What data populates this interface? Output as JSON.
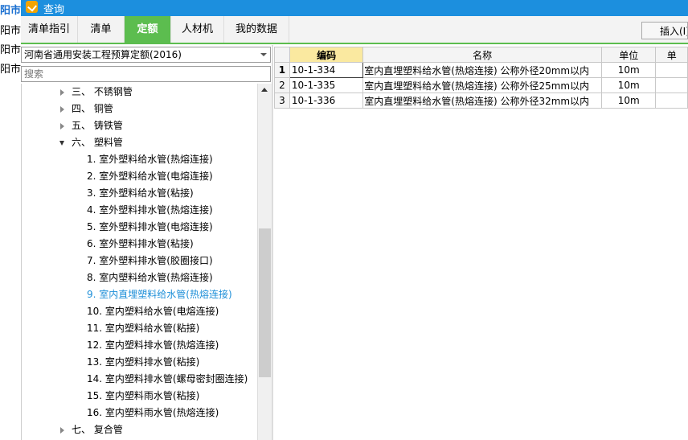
{
  "background_window": {
    "lines": [
      "阳市",
      "阳市",
      "阳市",
      "阳市"
    ]
  },
  "window": {
    "title": "查询"
  },
  "tabs": [
    {
      "label": "清单指引",
      "active": false
    },
    {
      "label": "清单",
      "active": false
    },
    {
      "label": "定额",
      "active": true
    },
    {
      "label": "人材机",
      "active": false
    },
    {
      "label": "我的数据",
      "active": false
    }
  ],
  "toolbar": {
    "insert_label": "插入(I)"
  },
  "quota_library": {
    "selected": "河南省通用安装工程预算定额(2016)"
  },
  "search": {
    "placeholder": "搜索",
    "value": ""
  },
  "tree": [
    {
      "label": "三、 不锈钢管",
      "state": "collapsed",
      "level": 0
    },
    {
      "label": "四、 铜管",
      "state": "collapsed",
      "level": 0
    },
    {
      "label": "五、 铸铁管",
      "state": "collapsed",
      "level": 0
    },
    {
      "label": "六、 塑料管",
      "state": "expanded",
      "level": 0
    },
    {
      "label": "1. 室外塑料给水管(热熔连接)",
      "level": 1
    },
    {
      "label": "2. 室外塑料给水管(电熔连接)",
      "level": 1
    },
    {
      "label": "3. 室外塑料给水管(粘接)",
      "level": 1
    },
    {
      "label": "4. 室外塑料排水管(热熔连接)",
      "level": 1
    },
    {
      "label": "5. 室外塑料排水管(电熔连接)",
      "level": 1
    },
    {
      "label": "6. 室外塑料排水管(粘接)",
      "level": 1
    },
    {
      "label": "7. 室外塑料排水管(胶圈接口)",
      "level": 1
    },
    {
      "label": "8. 室内塑料给水管(热熔连接)",
      "level": 1
    },
    {
      "label": "9. 室内直埋塑料给水管(热熔连接)",
      "level": 1,
      "selected": true
    },
    {
      "label": "10. 室内塑料给水管(电熔连接)",
      "level": 1
    },
    {
      "label": "11. 室内塑料给水管(粘接)",
      "level": 1
    },
    {
      "label": "12. 室内塑料排水管(热熔连接)",
      "level": 1
    },
    {
      "label": "13. 室内塑料排水管(粘接)",
      "level": 1
    },
    {
      "label": "14. 室内塑料排水管(螺母密封圈连接)",
      "level": 1
    },
    {
      "label": "15. 室内塑料雨水管(粘接)",
      "level": 1
    },
    {
      "label": "16. 室内塑料雨水管(热熔连接)",
      "level": 1
    },
    {
      "label": "七、 复合管",
      "state": "collapsed",
      "level": 0
    }
  ],
  "table": {
    "columns": [
      "",
      "编码",
      "名称",
      "单位",
      "单"
    ],
    "rows": [
      {
        "no": "1",
        "code": "10-1-334",
        "name": "室内直埋塑料给水管(热熔连接) 公称外径20mm以内",
        "unit": "10m",
        "current": true
      },
      {
        "no": "2",
        "code": "10-1-335",
        "name": "室内直埋塑料给水管(热熔连接) 公称外径25mm以内",
        "unit": "10m"
      },
      {
        "no": "3",
        "code": "10-1-336",
        "name": "室内直埋塑料给水管(热熔连接) 公称外径32mm以内",
        "unit": "10m"
      }
    ]
  }
}
